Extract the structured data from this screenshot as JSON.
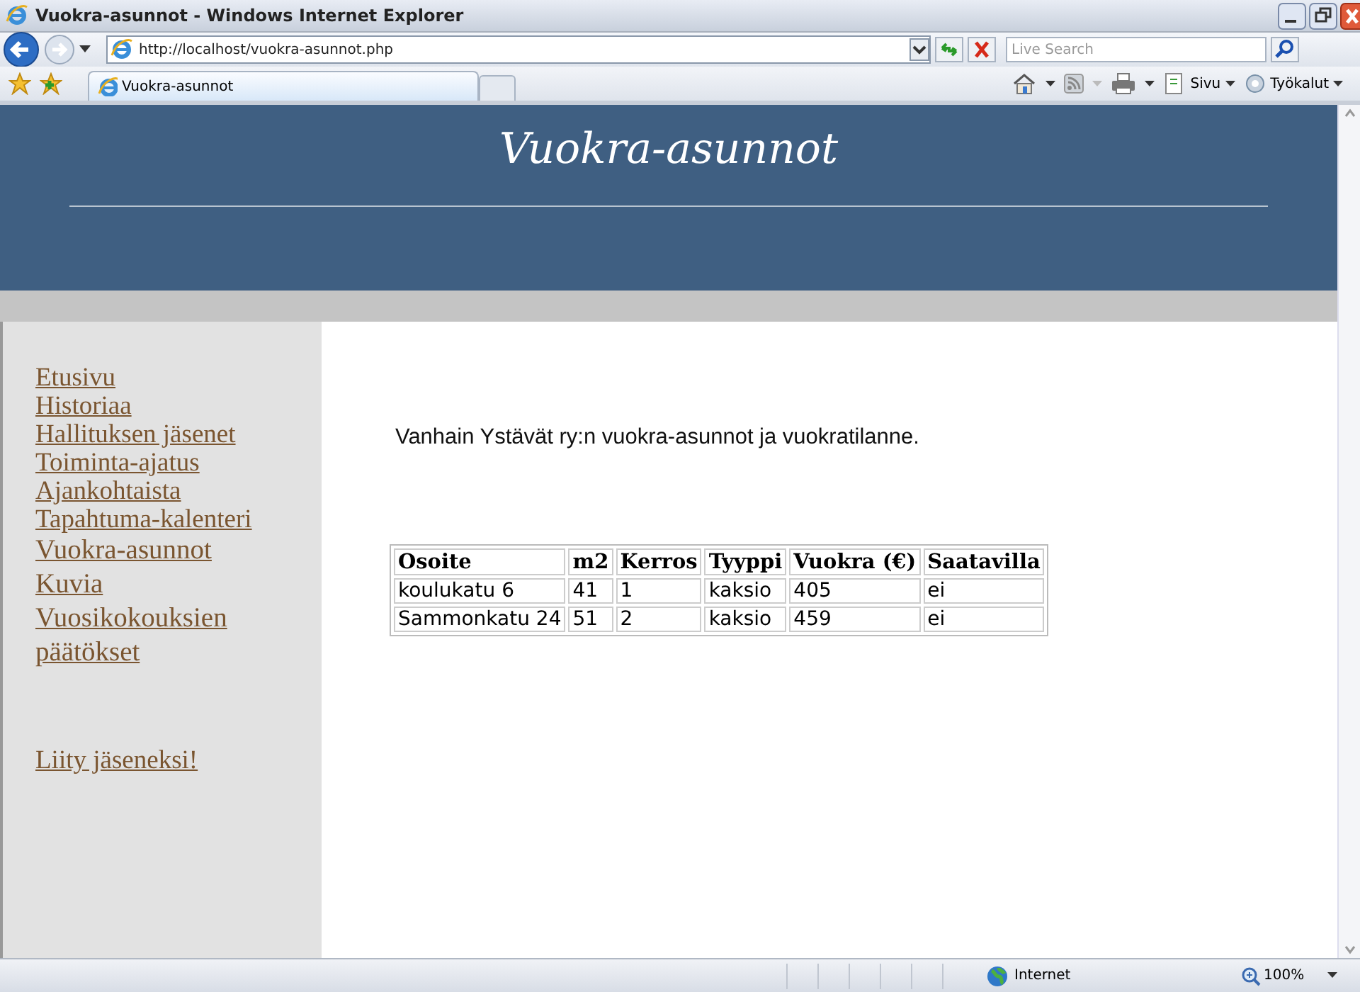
{
  "window": {
    "title": "Vuokra-asunnot - Windows Internet Explorer"
  },
  "address_bar": {
    "url": "http://localhost/vuokra-asunnot.php",
    "search_placeholder": "Live Search"
  },
  "tabs": [
    {
      "label": "Vuokra-asunnot",
      "selected": true
    }
  ],
  "command_bar": [
    "Sivu",
    "Työkalut"
  ],
  "page": {
    "site_title": "Vuokra-asunnot",
    "nav": [
      {
        "label": "Etusivu"
      },
      {
        "label": "Historiaa"
      },
      {
        "label": "Hallituksen jäsenet"
      },
      {
        "label": "Toiminta-ajatus"
      },
      {
        "label": "Ajankohtaista"
      },
      {
        "label": "Tapahtuma-kalenteri"
      },
      {
        "label": "Vuokra-asunnot"
      },
      {
        "label": "Kuvia"
      },
      {
        "label": "Vuosikokouksien päätökset"
      }
    ],
    "join_link": "Liity jäseneksi!",
    "intro": "Vanhain Ystävät ry:n vuokra-asunnot ja vuokratilanne.",
    "table": {
      "columns": [
        "Osoite",
        "m2",
        "Kerros",
        "Tyyppi",
        "Vuokra (€)",
        "Saatavilla"
      ],
      "rows": [
        [
          "koulukatu 6",
          "41",
          "1",
          "kaksio",
          "405",
          "ei"
        ],
        [
          "Sammonkatu 24",
          "51",
          "2",
          "kaksio",
          "459",
          "ei"
        ]
      ]
    }
  },
  "status_bar": {
    "zone": "Internet",
    "zoom": "100%"
  }
}
